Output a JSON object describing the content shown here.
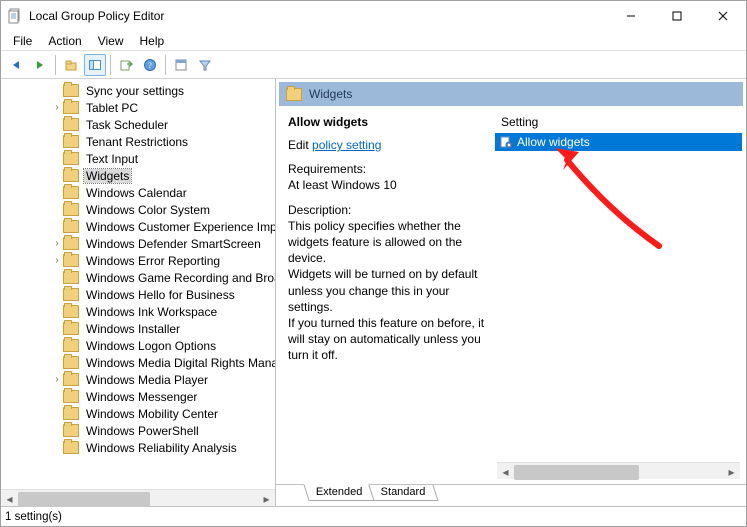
{
  "title": "Local Group Policy Editor",
  "menu": [
    "File",
    "Action",
    "View",
    "Help"
  ],
  "tree": {
    "items": [
      {
        "label": "Sync your settings",
        "exp": ""
      },
      {
        "label": "Tablet PC",
        "exp": ">"
      },
      {
        "label": "Task Scheduler",
        "exp": ""
      },
      {
        "label": "Tenant Restrictions",
        "exp": ""
      },
      {
        "label": "Text Input",
        "exp": ""
      },
      {
        "label": "Widgets",
        "exp": "",
        "sel": true
      },
      {
        "label": "Windows Calendar",
        "exp": ""
      },
      {
        "label": "Windows Color System",
        "exp": ""
      },
      {
        "label": "Windows Customer Experience Improvement",
        "exp": ""
      },
      {
        "label": "Windows Defender SmartScreen",
        "exp": ">"
      },
      {
        "label": "Windows Error Reporting",
        "exp": ">"
      },
      {
        "label": "Windows Game Recording and Broadcasting",
        "exp": ""
      },
      {
        "label": "Windows Hello for Business",
        "exp": ""
      },
      {
        "label": "Windows Ink Workspace",
        "exp": ""
      },
      {
        "label": "Windows Installer",
        "exp": ""
      },
      {
        "label": "Windows Logon Options",
        "exp": ""
      },
      {
        "label": "Windows Media Digital Rights Management",
        "exp": ""
      },
      {
        "label": "Windows Media Player",
        "exp": ">"
      },
      {
        "label": "Windows Messenger",
        "exp": ""
      },
      {
        "label": "Windows Mobility Center",
        "exp": ""
      },
      {
        "label": "Windows PowerShell",
        "exp": ""
      },
      {
        "label": "Windows Reliability Analysis",
        "exp": ""
      }
    ]
  },
  "detail": {
    "category": "Widgets",
    "heading": "Allow widgets",
    "edit_prefix": "Edit",
    "edit_link": "policy setting ",
    "req_label": "Requirements:",
    "req_text": "At least Windows 10",
    "desc_label": "Description:",
    "desc_p1": "This policy specifies whether the widgets feature is allowed on the device.",
    "desc_p2": "Widgets will be turned on by default unless you change this in your settings.",
    "desc_p3": "If you turned this feature on before, it will stay on automatically unless you turn it off.",
    "setting_col": "Setting",
    "setting_row": "Allow widgets",
    "tabs": [
      "Extended",
      "Standard"
    ]
  },
  "status": "1 setting(s)"
}
